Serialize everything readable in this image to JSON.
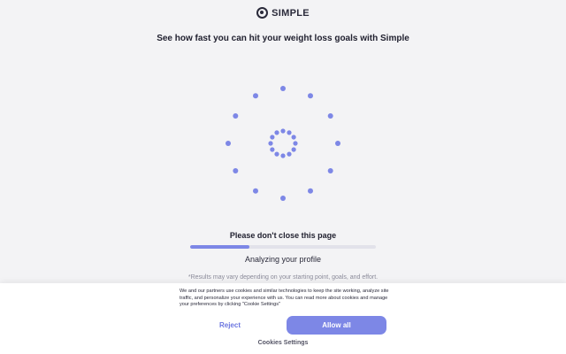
{
  "brand": {
    "name": "SIMPLE",
    "logo_icon": "brand-logo-icon"
  },
  "headline": "See how fast you can hit your weight loss goals with Simple",
  "loader": {
    "accent": "#7d87e6",
    "icon": "loading-spinner-icon"
  },
  "note": "Please don't close this page",
  "progress": {
    "fraction": 0.32,
    "fill_color": "#7d87e6",
    "track_color": "#e2e2ea"
  },
  "status": "Analyzing your profile",
  "disclaimer": "*Results may vary depending on your starting point, goals, and effort.",
  "cookie_banner": {
    "text": "We and our partners use cookies and similar technologies to keep the site working, analyze site traffic, and personalize your experience with us. You can read more about cookies and manage your preferences by clicking \"Cookie Settings\"",
    "reject_label": "Reject",
    "allow_label": "Allow all",
    "settings_label": "Cookies Settings"
  }
}
